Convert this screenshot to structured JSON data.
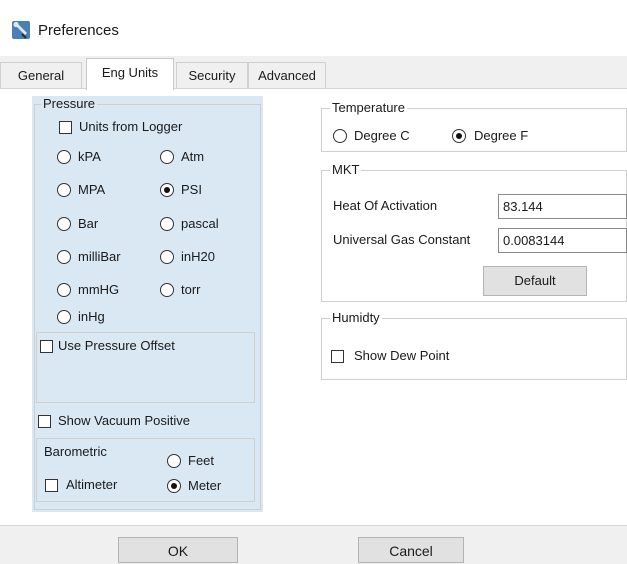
{
  "window": {
    "title": "Preferences",
    "icon": "wrench-icon"
  },
  "tabs": [
    {
      "label": "General",
      "active": false
    },
    {
      "label": "Eng Units",
      "active": true
    },
    {
      "label": "Security",
      "active": false
    },
    {
      "label": "Advanced",
      "active": false
    }
  ],
  "pressure": {
    "legend": "Pressure",
    "units_from_logger": {
      "label": "Units from Logger",
      "checked": false
    },
    "units": [
      {
        "label": "kPA",
        "checked": false
      },
      {
        "label": "Atm",
        "checked": false
      },
      {
        "label": "MPA",
        "checked": false
      },
      {
        "label": "PSI",
        "checked": true
      },
      {
        "label": "Bar",
        "checked": false
      },
      {
        "label": "pascal",
        "checked": false
      },
      {
        "label": "milliBar",
        "checked": false
      },
      {
        "label": "inH20",
        "checked": false
      },
      {
        "label": "mmHG",
        "checked": false
      },
      {
        "label": "torr",
        "checked": false
      },
      {
        "label": "inHg",
        "checked": false
      }
    ],
    "use_pressure_offset": {
      "label": "Use Pressure Offset",
      "checked": false
    },
    "show_vacuum_positive": {
      "label": "Show Vacuum Positive",
      "checked": false
    },
    "barometric": {
      "legend": "Barometric",
      "altimeter": {
        "label": "Altimeter",
        "checked": false
      },
      "feet": {
        "label": "Feet",
        "checked": false
      },
      "meter": {
        "label": "Meter",
        "checked": true
      }
    }
  },
  "temperature": {
    "legend": "Temperature",
    "degree_c": {
      "label": "Degree C",
      "checked": false
    },
    "degree_f": {
      "label": "Degree F",
      "checked": true
    }
  },
  "mkt": {
    "legend": "MKT",
    "heat_of_activation": {
      "label": "Heat Of Activation",
      "value": "83.144"
    },
    "universal_gas_constant": {
      "label": "Universal Gas Constant",
      "value": "0.0083144"
    },
    "default_label": "Default"
  },
  "humidity": {
    "legend": "Humidty",
    "show_dew_point": {
      "label": "Show Dew Point",
      "checked": false
    }
  },
  "footer": {
    "ok_label": "OK",
    "cancel_label": "Cancel"
  },
  "colors": {
    "pressure_panel_bg": "#dae8f4",
    "button_bg": "#e1e1e1",
    "tabstrip_bg": "#f0f0f0"
  }
}
